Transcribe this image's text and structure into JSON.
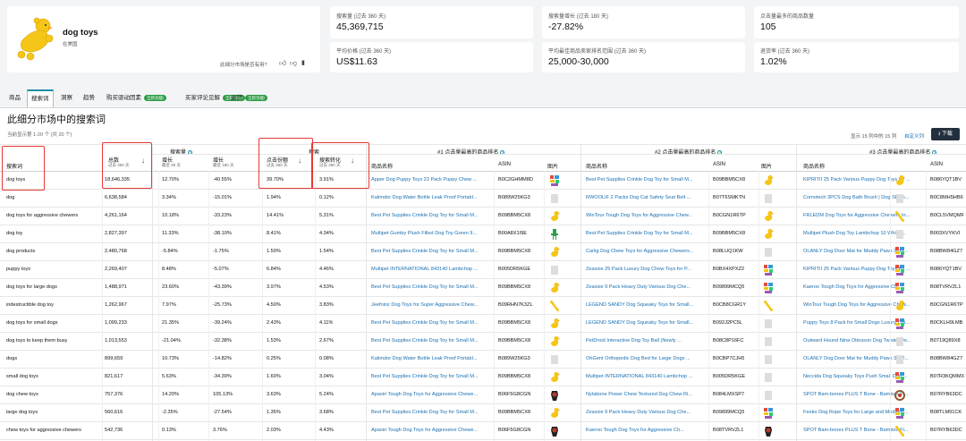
{
  "product_card": {
    "title": "dog toys",
    "marketplace": "在美国",
    "feedback_question": "此细分市场是否有用?"
  },
  "metrics": [
    {
      "label": "搜索量 (过去 360 天)",
      "value": "45,369,715"
    },
    {
      "label": "搜索量增长 (过去 180 天)",
      "value": "-27.82%"
    },
    {
      "label": "点击量最多的商品数量",
      "value": "105"
    },
    {
      "label": "平均价格 (过去 360 天)",
      "value": "US$11.63"
    },
    {
      "label": "平均最佳商品卖家排名范围 (过去 360 天)",
      "value": "25,000-30,000"
    },
    {
      "label": "退货率 (过去 360 天)",
      "value": "1.02%"
    }
  ],
  "tabs": [
    {
      "label": "商品",
      "badge": ""
    },
    {
      "label": "搜索词",
      "badge": ""
    },
    {
      "label": "洞察",
      "badge": ""
    },
    {
      "label": "趋势",
      "badge": ""
    },
    {
      "label": "购买驱动因素",
      "badge": "全新功能!"
    },
    {
      "label": "买家评论见解",
      "badge": "全新功能!"
    },
    {
      "label": "退货",
      "badge": "全新功能!"
    }
  ],
  "section": {
    "title": "此细分市场中的搜索词",
    "count_text": "当前显示第 1-20 个 (共 20 个)",
    "showing_columns": "显示 15 列中的 15 列",
    "customize": "自定义列",
    "download": "下载"
  },
  "headers": {
    "group_search_volume": "搜索量",
    "group_prefix": "搜索",
    "keyword": "搜索词",
    "total": "总数",
    "total_sub": "过去 360 天",
    "growth1": "增长",
    "growth1_sub": "最近 90 天",
    "growth2": "增长",
    "growth2_sub": "最近 180 天",
    "ctr": "点击份额",
    "ctr_sub": "过去 360 天",
    "conv": "搜索转化",
    "conv_sub": "过去 360 天",
    "group_p1": "#1 点击量最高的商品排名",
    "group_p2": "#2 点击量最高的商品排名",
    "group_p3": "#3 点击量最高的商品排名",
    "name": "商品名称",
    "asin": "ASIN",
    "image": "图片"
  },
  "rows": [
    {
      "kw": "dog toys",
      "total": "18,646,335",
      "g90": "12.70%",
      "g180": "-40.55%",
      "ctr": "39.70%",
      "conv": "3.91%",
      "p1": "Apper Dog Puppy Toys 23 Pack Puppy Chew ...",
      "a1": "B0C2GHMM8D",
      "p2": "Best Pet Supplies Crinkle Dog Toy for Small M...",
      "a2": "B09BBM5CX8",
      "p3": "KIPRITII 25 Pack Various Puppy Dog Toys for ...",
      "a3": "B086YQT1BV",
      "i1": "multi",
      "i2": "duck",
      "i3": "duck"
    },
    {
      "kw": "dog",
      "total": "6,638,584",
      "g90": "3.34%",
      "g180": "-15.01%",
      "ctr": "1.94%",
      "conv": "0.12%",
      "p1": "Kalimdor Dog Water Bottle Leak Proof Portabl...",
      "a1": "B089W25KG3",
      "p2": "RWOOLIF 2 Packs Dog Cat Safety Seat Belt ...",
      "a2": "B07T6SMKTN",
      "p3": "Comotech 3PCS Dog Bath Brush | Dog Sham...",
      "a3": "B0C8MH5HB6",
      "i1": "blank",
      "i2": "blank",
      "i3": "blank"
    },
    {
      "kw": "dog toys for aggressive chewers",
      "total": "4,261,164",
      "g90": "10.18%",
      "g180": "-33.23%",
      "ctr": "14.41%",
      "conv": "5.31%",
      "p1": "Best Pet Supplies Crinkle Dog Toy for Small M...",
      "a1": "B09BBM5CX8",
      "p2": "WinTour Tough Dog Toys for Aggressive Chew...",
      "a2": "B0CGN1R6TP",
      "p3": "FRLEDM Dog Toys for Aggressive Chewers In...",
      "a3": "B0CL5VMQMF",
      "i1": "duck",
      "i2": "duck",
      "i3": "bone"
    },
    {
      "kw": "dog toy",
      "total": "2,827,397",
      "g90": "11.33%",
      "g180": "-38.10%",
      "ctr": "8.41%",
      "conv": "4.34%",
      "p1": "Multipet Gumby Plush Filled Dog Toy Green 9...",
      "a1": "B00A8X1I9E",
      "p2": "Best Pet Supplies Crinkle Dog Toy for Small M...",
      "a2": "B09BBM5CX8",
      "p3": "Multipet Plush Dog Toy Lambchop 10 White/...",
      "a3": "B003XVYKVI",
      "i1": "green",
      "i2": "duck",
      "i3": "blank"
    },
    {
      "kw": "dog products",
      "total": "2,480,768",
      "g90": "-5.84%",
      "g180": "-1.75%",
      "ctr": "1.50%",
      "conv": "1.54%",
      "p1": "Best Pet Supplies Crinkle Dog Toy for Small M...",
      "a1": "B09BBM5CX8",
      "p2": "Carlig Dog Chew Toys for Aggressive Chewers...",
      "a2": "B08LUQ1KW",
      "p3": "OLANLY Dog Door Mat for Muddy Paws 30x2...",
      "a3": "B08BW84GZ7",
      "i1": "duck",
      "i2": "blank",
      "i3": "multi"
    },
    {
      "kw": "puppy toys",
      "total": "2,269,407",
      "g90": "8.48%",
      "g180": "-5.07%",
      "ctr": "6.84%",
      "conv": "4.46%",
      "p1": "Multipet INTERNATIONAL 843140 Lambchop ...",
      "a1": "B005DR5KGE",
      "p2": "Zeaxsie 25 Pack Luxury Dog Chew Toys for P...",
      "a2": "B0BX4XPXZ2",
      "p3": "KIPRITII 25 Pack Various Puppy Dog Toys for ...",
      "a3": "B086YQT1BV",
      "i1": "blank",
      "i2": "multi",
      "i3": "multi"
    },
    {
      "kw": "dog toys for large dogs",
      "total": "1,488,971",
      "g90": "23.60%",
      "g180": "-43.39%",
      "ctr": "3.97%",
      "conv": "4.53%",
      "p1": "Best Pet Supplies Crinkle Dog Toy for Small M...",
      "a1": "B09BBM5CX8",
      "p2": "Zeaxsie 9 Pack Heavy Duty Various Dog Che...",
      "a2": "B09899MCQ5",
      "p3": "Kaeroo Tough Dog Toys for Aggressive Ch...",
      "a3": "B08TVRVZL1",
      "i1": "duck",
      "i2": "multi",
      "i3": "multi"
    },
    {
      "kw": "indestructible dog toy",
      "total": "1,262,967",
      "g90": "7.97%",
      "g180": "-25.73%",
      "ctr": "4.50%",
      "conv": "3.83%",
      "p1": "Jeefoinz Dog Toys for Super Aggressive Chew...",
      "a1": "B09RHN7K3ZL",
      "p2": "LEGEND SANDY Dog Squeaky Toys for Small...",
      "a2": "B0CB8CGR1Y",
      "p3": "WinTour Tough Dog Toys for Aggressive Chew...",
      "a3": "B0CGN1R6TP",
      "i1": "bone",
      "i2": "bone",
      "i3": "duck"
    },
    {
      "kw": "dog toys for small dogs",
      "total": "1,099,233",
      "g90": "21.35%",
      "g180": "-39.24%",
      "ctr": "2.43%",
      "conv": "4.11%",
      "p1": "Best Pet Supplies Crinkle Dog Toy for Small M...",
      "a1": "B09BBM5CX8",
      "p2": "LEGEND SANDY Dog Squeaky Toys for Small...",
      "a2": "B092J2PC5L",
      "p3": "Puppy Toys 8 Pack for Small Dogs Luxury Chi...",
      "a3": "B0CKLH9LMB",
      "i1": "duck",
      "i2": "blank",
      "i3": "multi"
    },
    {
      "kw": "dog toys to keep them busy",
      "total": "1,013,553",
      "g90": "-21.04%",
      "g180": "-32.38%",
      "ctr": "1.53%",
      "conv": "2.67%",
      "p1": "Best Pet Supplies Crinkle Dog Toy for Small M...",
      "a1": "B09BBM5CX8",
      "p2": "PetDroid Interactive Dog Toy Ball (Newly ...",
      "a2": "B08C8P16FC",
      "p3": "Outward Hound Nina Ottosson Dog Twister Do...",
      "a3": "B0719Q89X8",
      "i1": "duck",
      "i2": "blank",
      "i3": "blank"
    },
    {
      "kw": "dogs",
      "total": "899,659",
      "g90": "10.73%",
      "g180": "-14.82%",
      "ctr": "0.25%",
      "conv": "0.08%",
      "p1": "Kalimdor Dog Water Bottle Leak Proof Portabl...",
      "a1": "B089W25KG3",
      "p2": "OhGent Orthopedic Dog Bed for Large Dogs ...",
      "a2": "B0CBP7CJH5",
      "p3": "OLANLY Dog Door Mat for Muddy Paws 30x2...",
      "a3": "B08BW84GZ7",
      "i1": "blank",
      "i2": "blank",
      "i3": "blank"
    },
    {
      "kw": "small dog toys",
      "total": "821,617",
      "g90": "5.63%",
      "g180": "-34.39%",
      "ctr": "1.60%",
      "conv": "3.04%",
      "p1": "Best Pet Supplies Crinkle Dog Toy for Small M...",
      "a1": "B09BBM5CX8",
      "p2": "Multipet INTERNATIONAL 843140 Lambchop ...",
      "a2": "B005DR5KGE",
      "p3": "Neccida Dog Squeaky Toys Push Small Dog ...",
      "a3": "B07R3KQMMX",
      "i1": "duck",
      "i2": "blank",
      "i3": "multi"
    },
    {
      "kw": "dog chew toys",
      "total": "757,376",
      "g90": "14.20%",
      "g180": "105.13%",
      "ctr": "3.63%",
      "conv": "5.24%",
      "p1": "Apasiri Tough Dog Toys for Aggressive Chewe...",
      "a1": "B06F5G8CGN",
      "p2": "Nylabone Power Chew Textured Dog Chew Ri...",
      "a2": "B084LMXSP7",
      "p3": "SPOT Bam-bones PLUS T Bone - Bamboo Fi...",
      "a3": "B07RYB63DC",
      "i1": "red",
      "i2": "blank",
      "i3": "ring"
    },
    {
      "kw": "large dog toys",
      "total": "560,616",
      "g90": "-2.35%",
      "g180": "-27.54%",
      "ctr": "1.35%",
      "conv": "3.68%",
      "p1": "Best Pet Supplies Crinkle Dog Toy for Small M...",
      "a1": "B09BBM5CX8",
      "p2": "Zeaxsie 9 Pack Heavy Duty Various Dog Che...",
      "a2": "B09899MCQ5",
      "p3": "Feeko Dog Rope Toys for Large and Medium ...",
      "a3": "B08TLM91CK",
      "i1": "duck",
      "i2": "multi",
      "i3": "multi"
    },
    {
      "kw": "chew toys for aggressive chewers",
      "total": "542,736",
      "g90": "0.13%",
      "g180": "3.76%",
      "ctr": "2.03%",
      "conv": "4.43%",
      "p1": "Apasiri Tough Dog Toys for Aggressive Chewe...",
      "a1": "B06F5G8CGN",
      "p2": "Kaeroo Tough Dog Toys for Aggressive Ch...",
      "a2": "B08TVRVZL1",
      "p3": "SPOT Bam-bones PLUS T Bone - Bamboo Fi...",
      "a3": "B07RYB63DC",
      "i1": "red",
      "i2": "red",
      "i3": "bone"
    }
  ]
}
